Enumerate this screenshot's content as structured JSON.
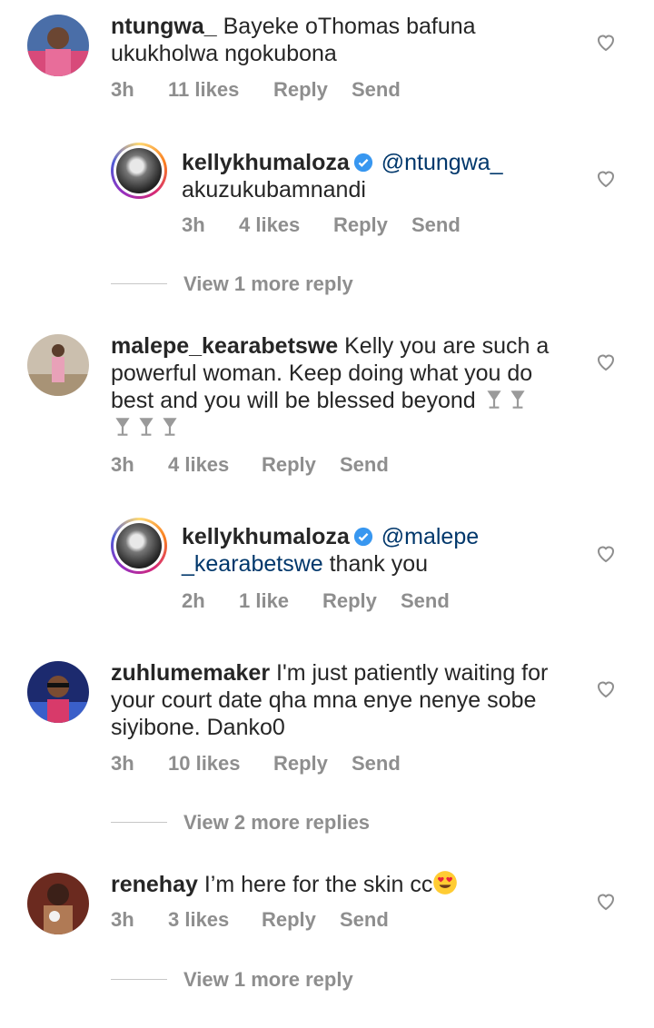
{
  "comments": [
    {
      "username": "ntungwa_",
      "lines": [
        "Bayeke oThomas bafuna",
        "ukukholwa ngokubona"
      ],
      "time": "3h",
      "likes": "11 likes",
      "reply": "Reply",
      "send": "Send",
      "avatar": "user-photo"
    },
    {
      "username": "kellykhumaloza",
      "verified": true,
      "mention": "@ntungwa_",
      "line2": "akuzukubamnandi",
      "time": "3h",
      "likes": "4 likes",
      "reply": "Reply",
      "send": "Send"
    },
    {
      "username": "malepe_kearabetswe",
      "lines": [
        "Kelly you are such a",
        "powerful woman. Keep doing what you do",
        "best and you will be blessed beyond"
      ],
      "emoji": "wine-glass-emoji",
      "time": "3h",
      "likes": "4 likes",
      "reply": "Reply",
      "send": "Send"
    },
    {
      "username": "kellykhumaloza",
      "verified": true,
      "mention_part1": "@malepe",
      "mention_part2": "_kearabetswe",
      "text_after": " thank you",
      "time": "2h",
      "likes": "1 like",
      "reply": "Reply",
      "send": "Send"
    },
    {
      "username": "zuhlumemaker",
      "lines": [
        "I'm just patiently waiting for",
        "your court date qha mna enye nenye sobe",
        "siyibone. Danko0"
      ],
      "time": "3h",
      "likes": "10 likes",
      "reply": "Reply",
      "send": "Send"
    },
    {
      "username": "renehay",
      "lines": [
        "I’m here for the skin cc"
      ],
      "emoji": "heart-eyes-emoji",
      "time": "3h",
      "likes": "3 likes",
      "reply": "Reply",
      "send": "Send"
    }
  ],
  "view_more": [
    "View 1 more reply",
    "View 2 more replies",
    "View 1 more reply"
  ],
  "colors": {
    "text": "#262626",
    "meta": "#8e8e8e",
    "mention": "#00376b",
    "verified": "#3897f0"
  }
}
